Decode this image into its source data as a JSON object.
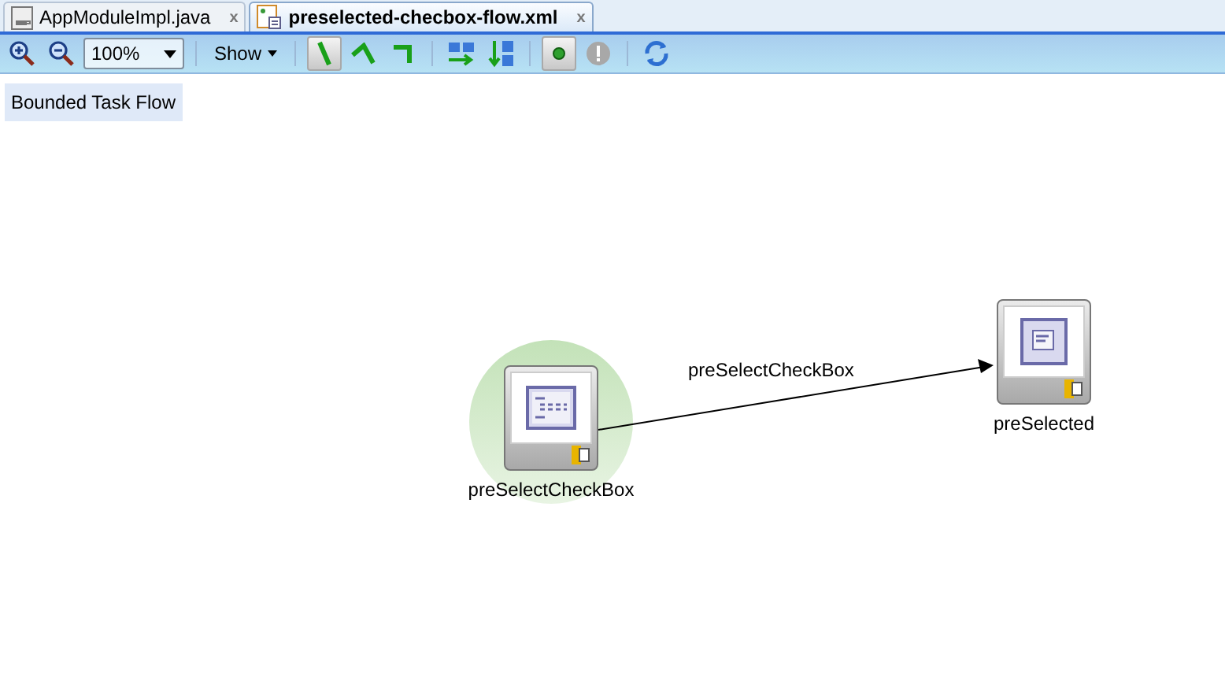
{
  "tabs": [
    {
      "label": "AppModuleImpl.java",
      "close": "x",
      "selected": false,
      "kind": "java"
    },
    {
      "label": "preselected-checbox-flow.xml",
      "close": "x",
      "selected": true,
      "kind": "flow"
    }
  ],
  "toolbar": {
    "items": [
      {
        "kind": "zoom-in"
      },
      {
        "kind": "zoom-out"
      },
      {
        "kind": "combo",
        "value": "100%"
      },
      {
        "kind": "sep"
      },
      {
        "kind": "menu",
        "label": "Show"
      },
      {
        "kind": "sep"
      },
      {
        "kind": "line-straight",
        "pressed": true
      },
      {
        "kind": "line-angled",
        "pressed": false
      },
      {
        "kind": "line-elbow",
        "pressed": false
      },
      {
        "kind": "sep"
      },
      {
        "kind": "layout-horizontal",
        "pressed": false
      },
      {
        "kind": "layout-vertical",
        "pressed": false
      },
      {
        "kind": "sep"
      },
      {
        "kind": "toggle-dot",
        "pressed": true
      },
      {
        "kind": "warning",
        "pressed": false
      },
      {
        "kind": "sep"
      },
      {
        "kind": "refresh",
        "pressed": false
      }
    ]
  },
  "diagram": {
    "title": "Bounded Task Flow",
    "nodes": [
      {
        "label": "preSelectCheckBox",
        "kind": "view",
        "default": true
      },
      {
        "label": "preSelected",
        "kind": "page",
        "default": false
      }
    ],
    "edges": [
      {
        "label": "preSelectCheckBox"
      }
    ]
  }
}
